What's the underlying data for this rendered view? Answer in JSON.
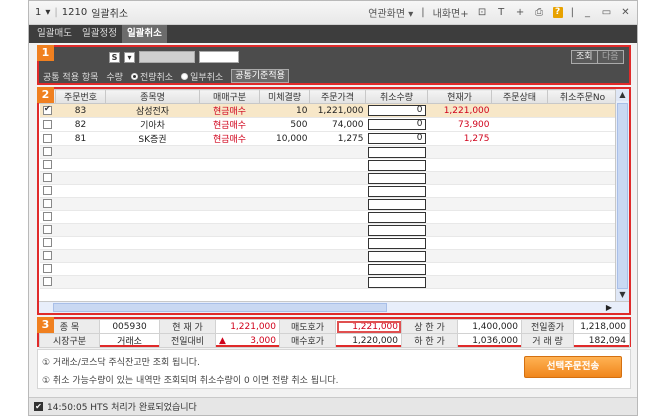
{
  "titlebar": {
    "menu": "1",
    "screen_no": "1210",
    "title": "일괄취소",
    "related": "연관화면",
    "my_screen": "내화면+",
    "icons": [
      "window-icon",
      "text-icon",
      "plus-icon",
      "print-icon",
      "help-icon",
      "minimize-icon",
      "maximize-icon",
      "close-icon"
    ],
    "t_label": "T",
    "plus_label": "+",
    "q_label": "?"
  },
  "tabs": [
    {
      "label": "일괄매도"
    },
    {
      "label": "일괄정정"
    },
    {
      "label": "일괄취소"
    }
  ],
  "badges": {
    "s1": "1",
    "s2": "2",
    "s3": "3"
  },
  "section1": {
    "s_label": "S",
    "query_button": "조회",
    "next_button": "다음",
    "common_label": "공통 적용 항목",
    "qty_label": "수량",
    "radio_all": "전량취소",
    "radio_part": "일부취소",
    "apply_button": "공통기준적용"
  },
  "table": {
    "headers": [
      "주문번호",
      "종목명",
      "매매구분",
      "미체결량",
      "주문가격",
      "취소수량",
      "현재가",
      "주문상태",
      "취소주문No"
    ],
    "rows": [
      {
        "order_no": "83",
        "name": "삼성전자",
        "type": "현금매수",
        "unfilled": "10",
        "price": "1,221,000",
        "cancel_qty": "0",
        "current": "1,221,000",
        "checked": true
      },
      {
        "order_no": "82",
        "name": "기아차",
        "type": "현금매수",
        "unfilled": "500",
        "price": "74,000",
        "cancel_qty": "0",
        "current": "73,900",
        "checked": false
      },
      {
        "order_no": "81",
        "name": "SK증권",
        "type": "현금매수",
        "unfilled": "10,000",
        "price": "1,275",
        "cancel_qty": "0",
        "current": "1,275",
        "checked": false
      }
    ],
    "empty_rows": 11
  },
  "info": {
    "code_label": "종 목",
    "code": "005930",
    "current_label": "현 재 가",
    "current": "1,221,000",
    "ask_label": "매도호가",
    "ask": "1,221,000",
    "upper_label": "상 한 가",
    "upper": "1,400,000",
    "prev_close_label": "전일종가",
    "prev_close": "1,218,000",
    "market_label": "시장구분",
    "market": "거래소",
    "change_label": "전일대비",
    "change_arrow": "▲",
    "change": "3,000",
    "bid_label": "매수호가",
    "bid": "1,220,000",
    "lower_label": "하 한 가",
    "lower": "1,036,000",
    "volume_label": "거 래 량",
    "volume": "182,094"
  },
  "notes": {
    "line1": "① 거래소/코스닥 주식잔고만 조회 됩니다.",
    "line2": "① 취소 가능수량이 있는 내역만 조회되며 취소수량이 0 이면 전량 취소 됩니다.",
    "send_button": "선택주문전송"
  },
  "status": {
    "text": "14:50:05  HTS 처리가 완료되었습니다"
  }
}
